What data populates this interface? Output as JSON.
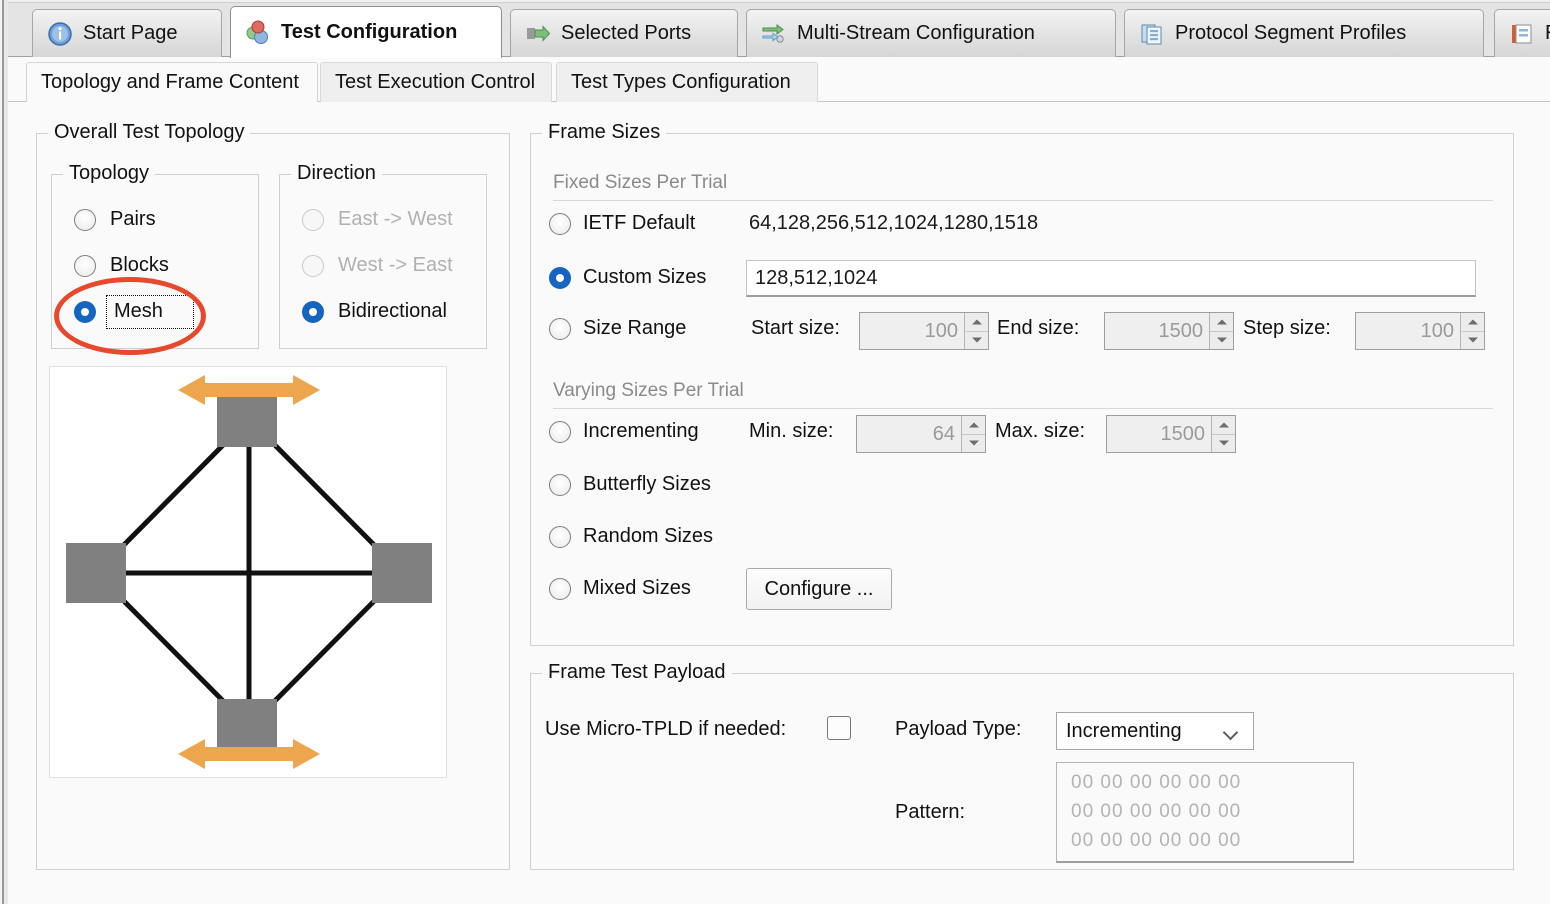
{
  "window": {
    "main_tabs": [
      {
        "label": "Start Page",
        "icon": "info-circle-icon",
        "active": false
      },
      {
        "label": "Test Configuration",
        "icon": "spheres-icon",
        "active": true
      },
      {
        "label": "Selected Ports",
        "icon": "green-arrow-ports-icon",
        "active": false
      },
      {
        "label": "Multi-Stream Configuration",
        "icon": "green-arrows-stream-icon",
        "active": false
      },
      {
        "label": "Protocol Segment Profiles",
        "icon": "blue-documents-icon",
        "active": false
      },
      {
        "label": "R",
        "icon": "notebook-report-icon",
        "active": false
      }
    ],
    "sub_tabs": [
      {
        "label": "Topology and Frame Content",
        "active": true
      },
      {
        "label": "Test Execution Control",
        "active": false
      },
      {
        "label": "Test Types Configuration",
        "active": false
      }
    ]
  },
  "topology_panel": {
    "title": "Overall Test Topology",
    "topology_group": {
      "title": "Topology",
      "options": [
        {
          "label": "Pairs",
          "selected": false,
          "disabled": false
        },
        {
          "label": "Blocks",
          "selected": false,
          "disabled": false
        },
        {
          "label": "Mesh",
          "selected": true,
          "disabled": false
        }
      ]
    },
    "direction_group": {
      "title": "Direction",
      "options": [
        {
          "label": "East -> West",
          "selected": false,
          "disabled": true
        },
        {
          "label": "West -> East",
          "selected": false,
          "disabled": true
        },
        {
          "label": "Bidirectional",
          "selected": true,
          "disabled": false
        }
      ]
    },
    "diagram": {
      "name": "mesh-topology-diagram",
      "node_count": 4,
      "node_color": "#808080",
      "link_color": "#111111",
      "arrow_color": "#eda64d"
    }
  },
  "frame_sizes": {
    "title": "Frame Sizes",
    "fixed_header": "Fixed Sizes Per Trial",
    "varying_header": "Varying Sizes Per Trial",
    "ietf": {
      "label": "IETF Default",
      "selected": false,
      "value": "64,128,256,512,1024,1280,1518"
    },
    "custom": {
      "label": "Custom Sizes",
      "selected": true,
      "value": "128,512,1024"
    },
    "size_range": {
      "label": "Size Range",
      "selected": false,
      "start_label": "Start size:",
      "start_value": "100",
      "end_label": "End size:",
      "end_value": "1500",
      "step_label": "Step size:",
      "step_value": "100"
    },
    "incrementing": {
      "label": "Incrementing",
      "selected": false,
      "min_label": "Min. size:",
      "min_value": "64",
      "max_label": "Max. size:",
      "max_value": "1500"
    },
    "butterfly": {
      "label": "Butterfly Sizes",
      "selected": false
    },
    "random": {
      "label": "Random Sizes",
      "selected": false
    },
    "mixed": {
      "label": "Mixed Sizes",
      "selected": false,
      "button_label": "Configure ..."
    }
  },
  "frame_test_payload": {
    "title": "Frame Test Payload",
    "micro_tpld_label": "Use Micro-TPLD if needed:",
    "micro_tpld_checked": false,
    "payload_type_label": "Payload Type:",
    "payload_type_value": "Incrementing",
    "pattern_label": "Pattern:",
    "pattern_rows": [
      "00  00  00  00  00  00",
      "00  00  00  00  00  00",
      "00  00  00  00  00  00"
    ]
  },
  "annotation": {
    "shape": "ellipse",
    "target": "mesh-radio-option",
    "color": "#e8482b"
  }
}
